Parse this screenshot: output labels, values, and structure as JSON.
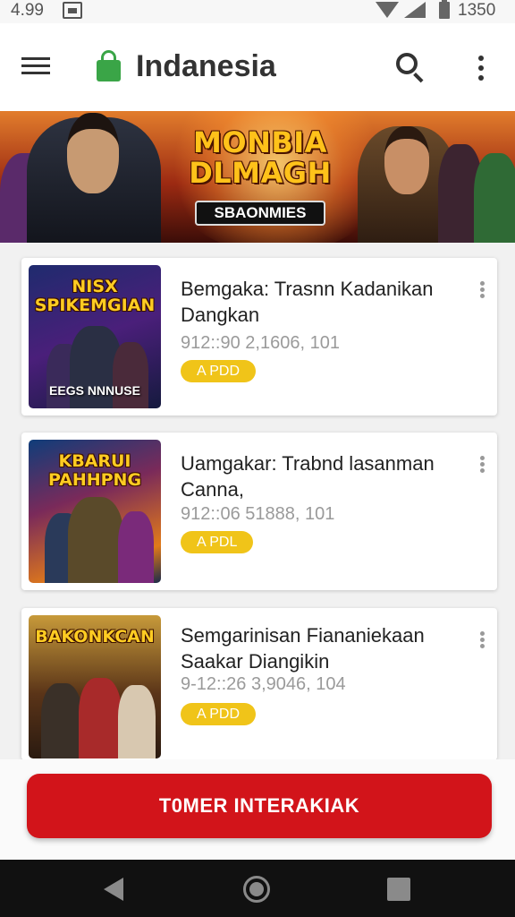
{
  "status_bar": {
    "time": "4.99",
    "battery_text": "1350",
    "icons": [
      "cast-icon",
      "wifi-icon",
      "signal-icon",
      "battery-icon"
    ]
  },
  "app_bar": {
    "title": "Indanesia",
    "icons": [
      "menu-icon",
      "lock-icon",
      "search-icon",
      "more-vertical-icon"
    ]
  },
  "banner": {
    "title": "MONBIA DLMAGH",
    "subtitle": "SBAONMIES"
  },
  "items": [
    {
      "thumb_title": "NISX SPIKEMGIAN",
      "thumb_sub": "EEGS NNNUSE",
      "title": "Bemgaka: Trasnn Kadanikan Dangkan",
      "meta": "912::90 2,1606, 101",
      "badge": "A PDD"
    },
    {
      "thumb_title": "KBARUI PAHHPNG",
      "thumb_sub": "",
      "title": "Uamgakar: Trabnd lasanman Canna,",
      "meta": "912::06 51888, 101",
      "badge": "A PDL"
    },
    {
      "thumb_title": "BAKONKCAN",
      "thumb_sub": "",
      "title": "Semgarinisan Fiananiekaan Saakar Diangikin",
      "meta": "9-12::26 3,9046, 104",
      "badge": "A PDD"
    }
  ],
  "cta": {
    "label": "T0MER INTERAKIAK"
  },
  "colors": {
    "accent_red": "#d2141a",
    "badge_yellow": "#f0c419",
    "lock_green": "#3aa547"
  }
}
